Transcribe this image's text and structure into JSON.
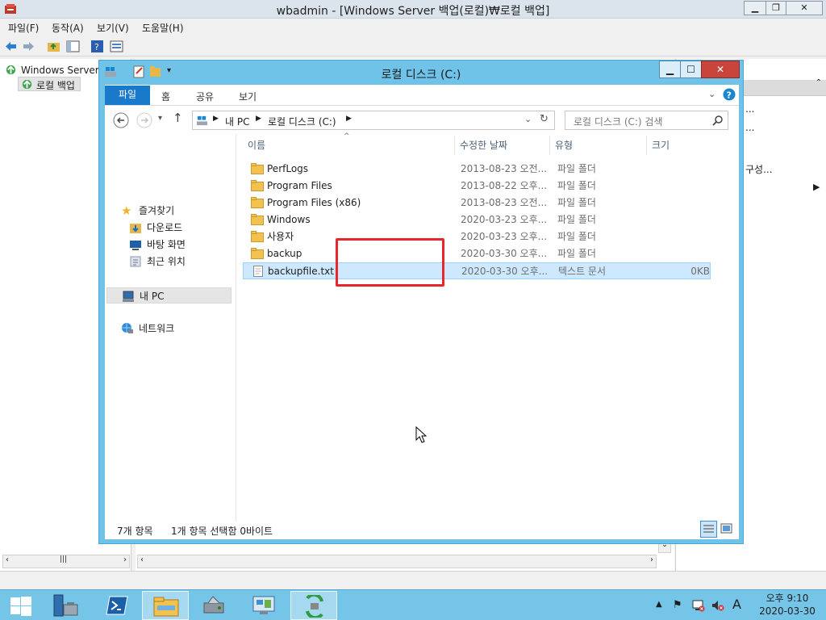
{
  "back_window": {
    "title": "wbadmin - [Windows Server 백업(로컬)₩로컬 백업]",
    "menu": [
      "파일(F)",
      "동작(A)",
      "보기(V)",
      "도움말(H)"
    ],
    "tree": {
      "root": "Windows Server 백",
      "child": "로컬 백업"
    },
    "right_pane": {
      "item1": "...",
      "item2": "...",
      "item3": "구성..."
    }
  },
  "explorer": {
    "title": "로컬 디스크 (C:)",
    "ribbon_tabs": [
      "파일",
      "홈",
      "공유",
      "보기"
    ],
    "address": {
      "pc": "내 PC",
      "drive": "로컬 디스크 (C:)"
    },
    "search_placeholder": "로컬 디스크 (C:) 검색",
    "nav": {
      "favorites": "즐겨찾기",
      "downloads": "다운로드",
      "desktop": "바탕 화면",
      "recent": "최근 위치",
      "this_pc": "내 PC",
      "network": "네트워크"
    },
    "columns": {
      "name": "이름",
      "modified": "수정한 날짜",
      "type": "유형",
      "size": "크기"
    },
    "files": [
      {
        "name": "PerfLogs",
        "modified": "2013-08-23 오전...",
        "type": "파일 폴더",
        "size": "",
        "kind": "folder"
      },
      {
        "name": "Program Files",
        "modified": "2013-08-22 오후...",
        "type": "파일 폴더",
        "size": "",
        "kind": "folder"
      },
      {
        "name": "Program Files (x86)",
        "modified": "2013-08-23 오전...",
        "type": "파일 폴더",
        "size": "",
        "kind": "folder"
      },
      {
        "name": "Windows",
        "modified": "2020-03-23 오후...",
        "type": "파일 폴더",
        "size": "",
        "kind": "folder"
      },
      {
        "name": "사용자",
        "modified": "2020-03-23 오후...",
        "type": "파일 폴더",
        "size": "",
        "kind": "folder"
      },
      {
        "name": "backup",
        "modified": "2020-03-30 오후...",
        "type": "파일 폴더",
        "size": "",
        "kind": "folder"
      },
      {
        "name": "backupfile.txt",
        "modified": "2020-03-30 오후...",
        "type": "텍스트 문서",
        "size": "0KB",
        "kind": "text"
      }
    ],
    "status": {
      "count": "7개 항목",
      "selection": "1개 항목 선택함 0바이트"
    }
  },
  "taskbar": {
    "clock_time": "오후 9:10",
    "clock_date": "2020-03-30",
    "ime": "A"
  },
  "colors": {
    "explorer_frame": "#6fc3e8",
    "taskbar": "#75c5e9",
    "highlight_box": "#e8262d",
    "selection": "#cde8ff"
  }
}
